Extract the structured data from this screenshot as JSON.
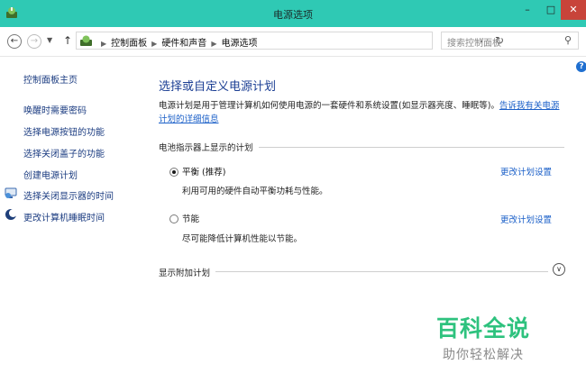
{
  "window": {
    "title": "电源选项"
  },
  "address_bar": {
    "crumbs": [
      "控制面板",
      "硬件和声音",
      "电源选项"
    ]
  },
  "search": {
    "placeholder": "搜索控制面板"
  },
  "sidebar": {
    "home": "控制面板主页",
    "items": [
      {
        "label": "唤醒时需要密码"
      },
      {
        "label": "选择电源按钮的功能"
      },
      {
        "label": "选择关闭盖子的功能"
      },
      {
        "label": "创建电源计划"
      },
      {
        "label": "选择关闭显示器的时间",
        "icon": "display-icon"
      },
      {
        "label": "更改计算机睡眠时间",
        "icon": "moon-icon"
      }
    ]
  },
  "main": {
    "title": "选择或自定义电源计划",
    "description": "电源计划是用于管理计算机如何使用电源的一套硬件和系统设置(如显示器亮度、睡眠等)。",
    "description_link": "告诉我有关电源计划的详细信息",
    "battery_section_label": "电池指示器上显示的计划",
    "plans": [
      {
        "name": "平衡 (推荐)",
        "description": "利用可用的硬件自动平衡功耗与性能。",
        "link": "更改计划设置",
        "selected": true
      },
      {
        "name": "节能",
        "description": "尽可能降低计算机性能以节能。",
        "link": "更改计划设置",
        "selected": false
      }
    ],
    "additional_plans_label": "显示附加计划"
  },
  "watermark": {
    "title": "百科全说",
    "subtitle": "助你轻松解决"
  },
  "colors": {
    "titlebar": "#2fc9b4",
    "close": "#c8443a",
    "link": "#1a5fc8",
    "heading": "#1c3f94",
    "watermark": "#2ec27e"
  }
}
